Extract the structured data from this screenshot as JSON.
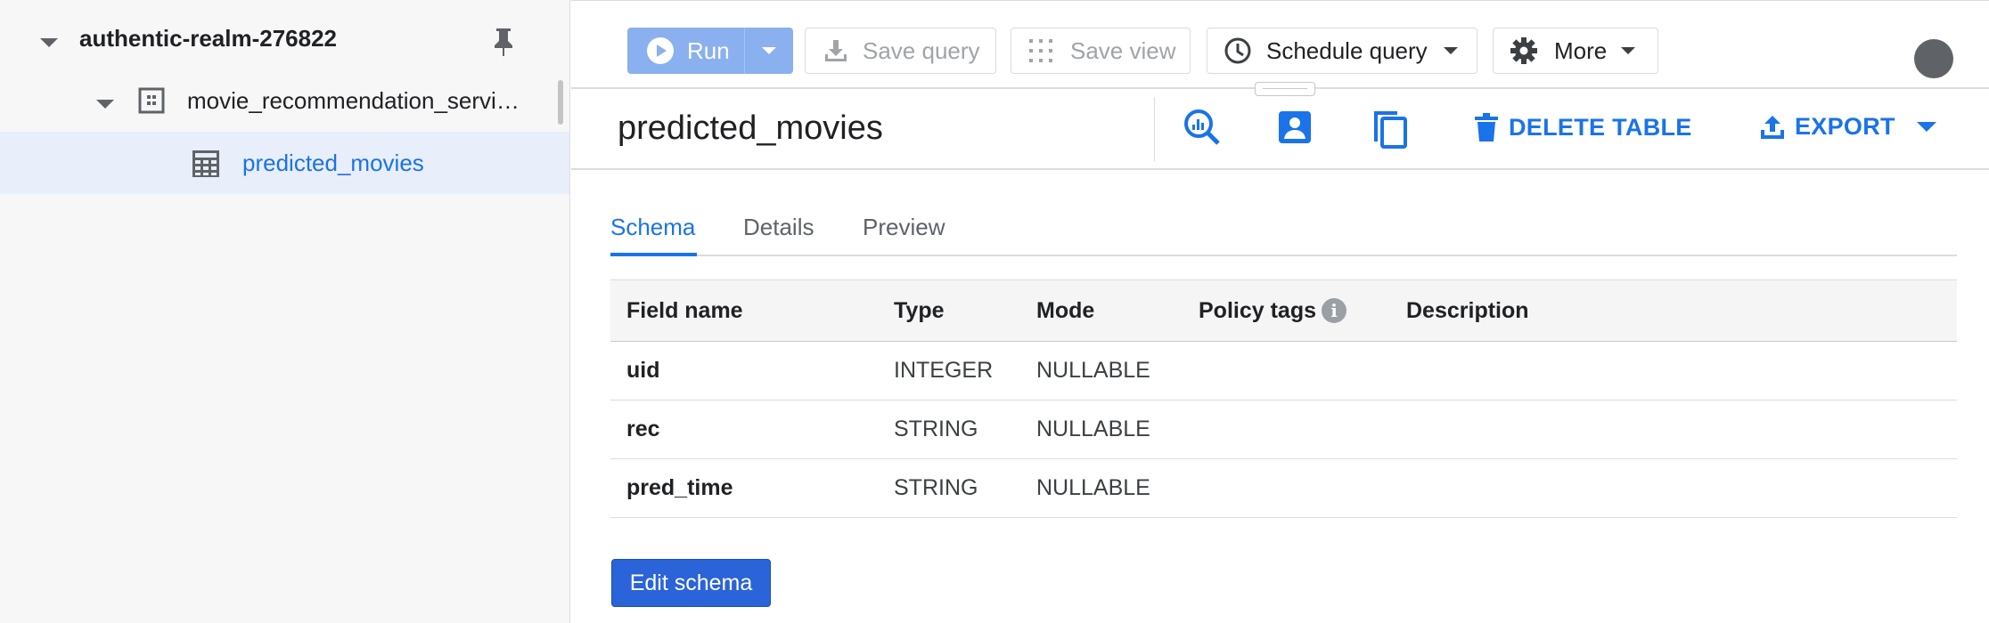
{
  "sidebar": {
    "project": {
      "label": "authentic-realm-276822"
    },
    "dataset": {
      "label": "movie_recommendation_servi…"
    },
    "table": {
      "label": "predicted_movies"
    }
  },
  "toolbar": {
    "run_label": "Run",
    "save_query_label": "Save query",
    "save_view_label": "Save view",
    "schedule_query_label": "Schedule query",
    "more_label": "More"
  },
  "table_header": {
    "title": "predicted_movies",
    "delete_label": "DELETE TABLE",
    "export_label": "EXPORT"
  },
  "tabs": [
    {
      "label": "Schema",
      "active": true
    },
    {
      "label": "Details",
      "active": false
    },
    {
      "label": "Preview",
      "active": false
    }
  ],
  "schema": {
    "columns": [
      "Field name",
      "Type",
      "Mode",
      "Policy tags",
      "Description"
    ],
    "rows": [
      {
        "field": "uid",
        "type": "INTEGER",
        "mode": "NULLABLE",
        "policy": "",
        "description": ""
      },
      {
        "field": "rec",
        "type": "STRING",
        "mode": "NULLABLE",
        "policy": "",
        "description": ""
      },
      {
        "field": "pred_time",
        "type": "STRING",
        "mode": "NULLABLE",
        "policy": "",
        "description": ""
      }
    ]
  },
  "edit_schema_label": "Edit schema",
  "info_icon_glyph": "i",
  "colors": {
    "accent": "#1a73e8",
    "run_disabled": "#8ab0ef",
    "selected_row": "#e8eefa",
    "edit_button": "#2b63d8"
  }
}
